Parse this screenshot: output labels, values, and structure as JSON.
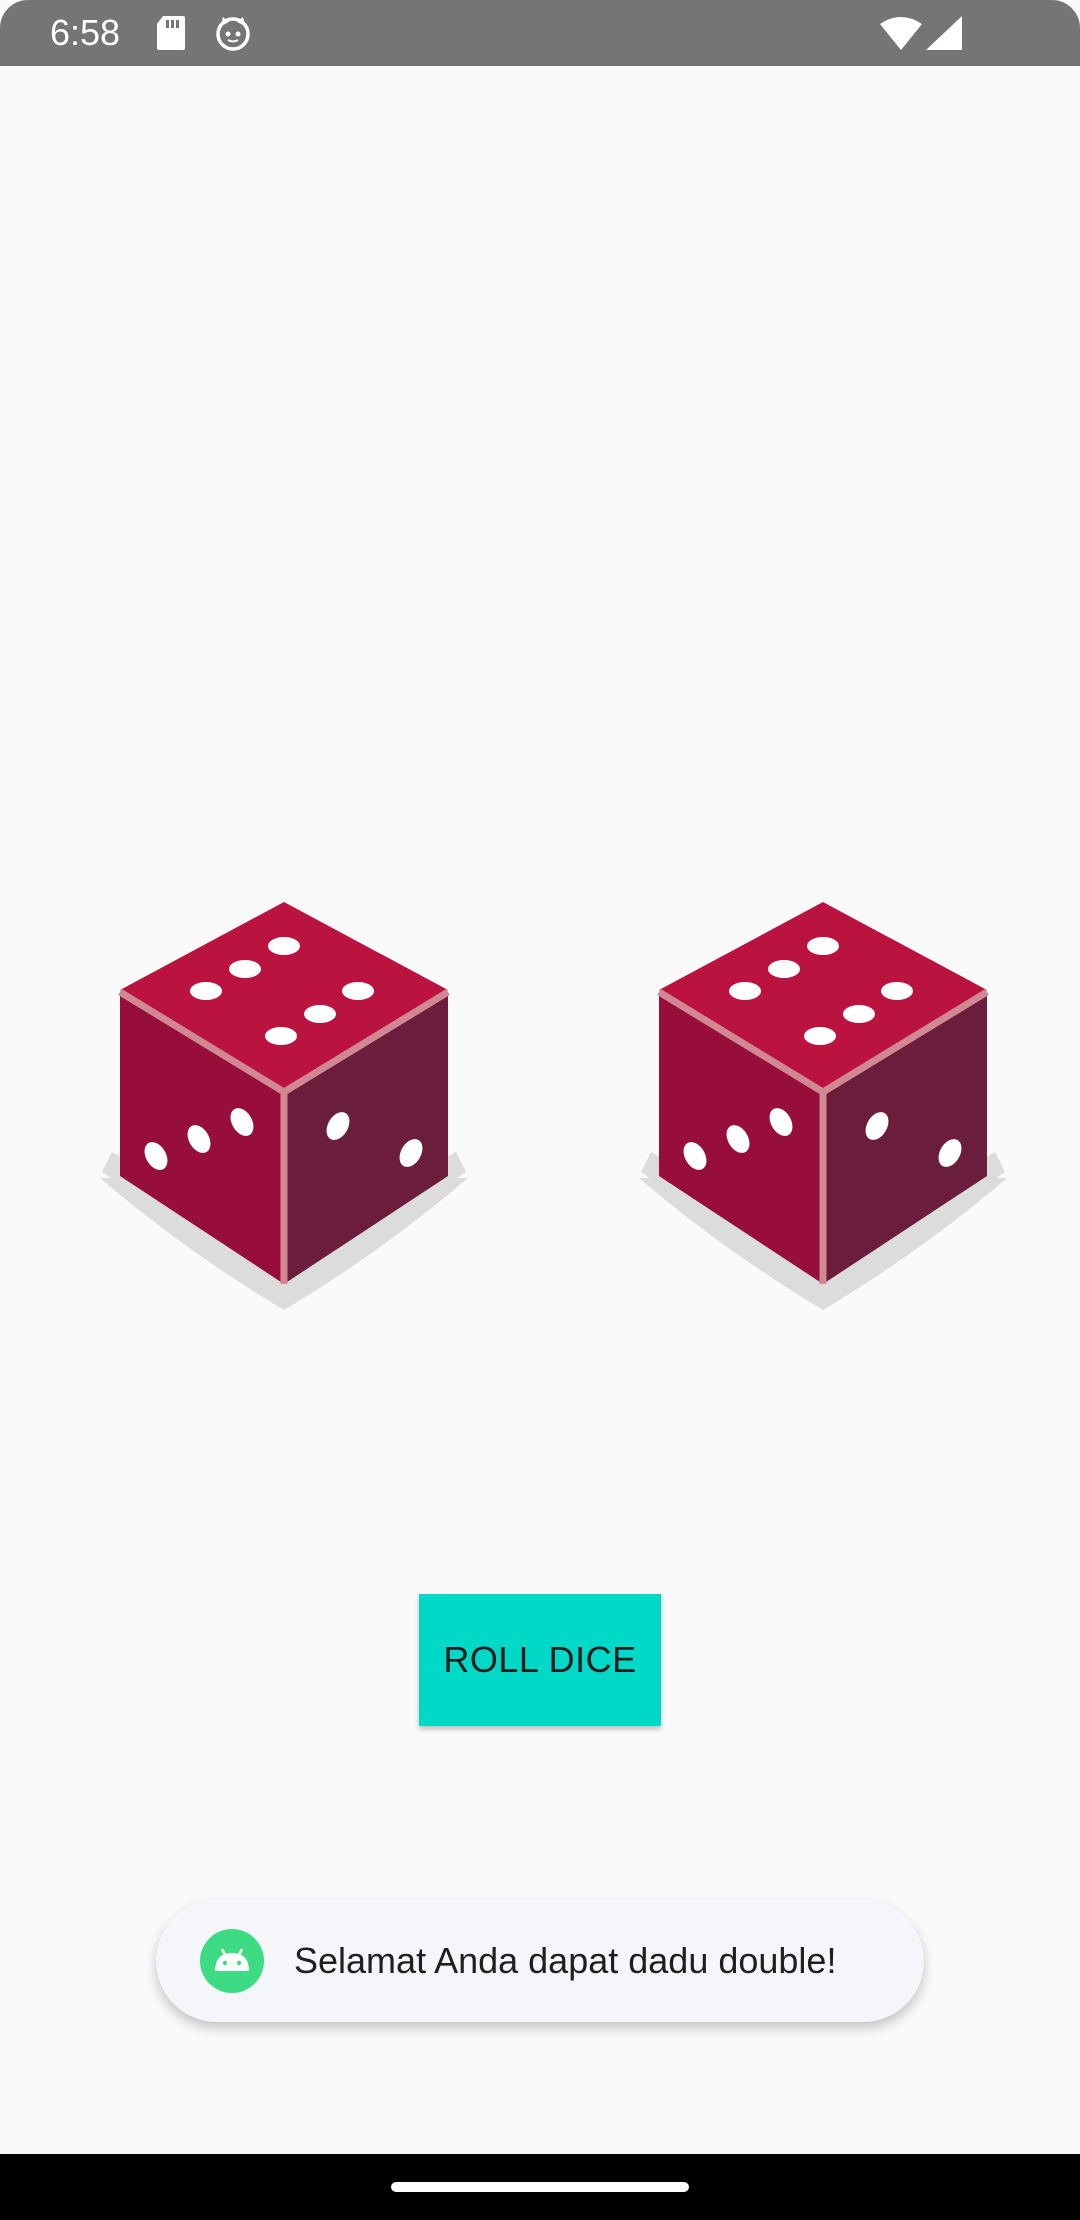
{
  "status_bar": {
    "time": "6:58",
    "icons": [
      "sd-card-icon",
      "cat-face-icon",
      "wifi-icon",
      "cell-signal-icon"
    ]
  },
  "dice": [
    {
      "name": "left-die",
      "top_face_value": 6
    },
    {
      "name": "right-die",
      "top_face_value": 6
    }
  ],
  "colors": {
    "top_face": "#bb1340",
    "left_face": "#970e3a",
    "right_face": "#6b1d3c",
    "edge": "#d18893",
    "shadow": "#dcdcdc",
    "button": "#00d9c7",
    "background": "#fafafa"
  },
  "roll_button": {
    "label": "ROLL DICE"
  },
  "toast": {
    "icon": "android-icon",
    "message": "Selamat Anda dapat dadu double!"
  }
}
